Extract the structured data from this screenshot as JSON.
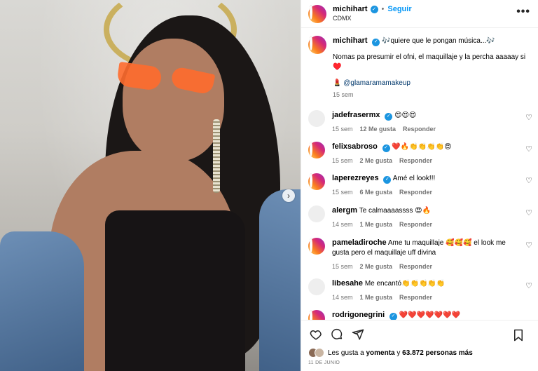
{
  "post": {
    "username": "michihart",
    "follow_label": "Seguir",
    "location": "CDMX",
    "more_label": "•••"
  },
  "caption": {
    "username": "michihart",
    "text": "🎶quiere que le pongan música...🎶",
    "line2": "Nomas pa presumir el ofni, el maquillaje y la percha aaaaay si ♥️",
    "credit_emoji": "💄",
    "credit_handle": "@glamaramamakeup",
    "time": "15 sem"
  },
  "comments": [
    {
      "username": "jadefrasermx",
      "verified": true,
      "text": "😍😍😍",
      "time": "15 sem",
      "likes": "12 Me gusta",
      "reply": "Responder"
    },
    {
      "username": "felixsabroso",
      "verified": true,
      "text": "❤️🔥👏👏👏👏😍",
      "time": "15 sem",
      "likes": "2 Me gusta",
      "reply": "Responder"
    },
    {
      "username": "laperezreyes",
      "verified": true,
      "text": "Amé el look!!!",
      "time": "15 sem",
      "likes": "6 Me gusta",
      "reply": "Responder"
    },
    {
      "username": "alergm",
      "verified": false,
      "text": "Te calmaaaassss 😍🔥",
      "time": "14 sem",
      "likes": "1 Me gusta",
      "reply": "Responder"
    },
    {
      "username": "pameladiroche",
      "verified": false,
      "text": "Ame tu maquillaje 🥰🥰🥰 el look me gusta pero el maquillaje uff divina",
      "time": "15 sem",
      "likes": "2 Me gusta",
      "reply": "Responder"
    },
    {
      "username": "libesahe",
      "verified": false,
      "text": "Me encantó👏👏👏👏👏",
      "time": "14 sem",
      "likes": "1 Me gusta",
      "reply": "Responder"
    },
    {
      "username": "rodrigonegrini",
      "verified": true,
      "text": "❤️❤️❤️❤️❤️❤️❤️",
      "time": "",
      "likes": "",
      "reply": ""
    }
  ],
  "likes": {
    "prefix": "Les gusta a ",
    "user": "yomenta",
    "middle": " y ",
    "count": "63.872 personas más"
  },
  "date": "11 DE JUNIO",
  "icons": {
    "heart": "heart-icon",
    "comment": "comment-icon",
    "share": "share-icon",
    "save": "bookmark-icon",
    "next": "chevron-right-icon"
  }
}
